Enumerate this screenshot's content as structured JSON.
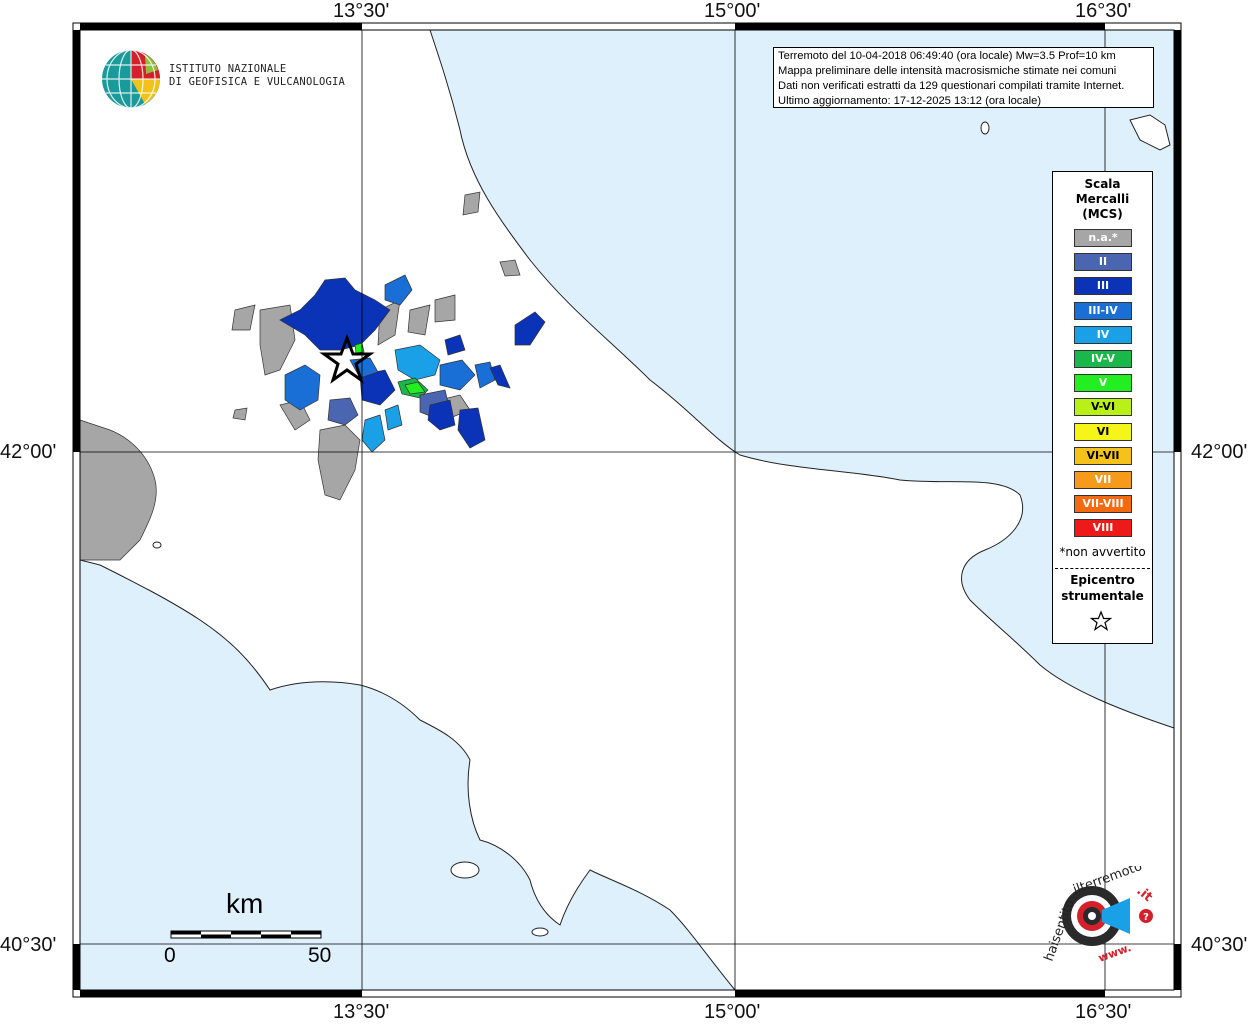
{
  "info": {
    "line1": "Terremoto del 10-04-2018 06:49:40 (ora locale) Mw=3.5 Prof=10 km",
    "line2": "Mappa preliminare delle intensità macrosismiche stimate nei comuni",
    "line3": "Dati non verificati estratti da 129 questionari compilati tramite Internet.",
    "line4": "Ultimo aggiornamento: 17-12-2025 13:12 (ora locale)"
  },
  "ticks": {
    "lon_13_30": "13°30'",
    "lon_15_00": "15°00'",
    "lon_16_30": "16°30'",
    "lat_42_00": "42°00'",
    "lat_40_30": "40°30'"
  },
  "logo": {
    "line1": "ISTITUTO NAZIONALE",
    "line2": "DI GEOFISICA E VULCANOLOGIA"
  },
  "legend": {
    "title1": "Scala",
    "title2": "Mercalli",
    "title3": "(MCS)",
    "classes": [
      {
        "label": "n.a.*",
        "color": "#a6a6a6"
      },
      {
        "label": "II",
        "color": "#4a66b0"
      },
      {
        "label": "III",
        "color": "#0a33b8"
      },
      {
        "label": "III-IV",
        "color": "#1a6fd6"
      },
      {
        "label": "IV",
        "color": "#1aa0e6"
      },
      {
        "label": "IV-V",
        "color": "#1ab84a"
      },
      {
        "label": "V",
        "color": "#22ee22"
      },
      {
        "label": "V-VI",
        "color": "#b8f018"
      },
      {
        "label": "VI",
        "color": "#f5f51a"
      },
      {
        "label": "VI-VII",
        "color": "#f5c21a"
      },
      {
        "label": "VII",
        "color": "#f59a1a"
      },
      {
        "label": "VII-VIII",
        "color": "#f56a10"
      },
      {
        "label": "VIII",
        "color": "#ee1a1a"
      }
    ],
    "note": "*non avvertito",
    "epi1": "Epicentro",
    "epi2": "strumentale"
  },
  "scalebar": {
    "unit": "km",
    "min": "0",
    "max": "50"
  },
  "hsl_logo": {
    "text1": "haisentito",
    "text2": "ilterremoto",
    "text3": ".it",
    "text4": "www."
  },
  "colors": {
    "sea": "#dff0fd",
    "land": "#ffffff",
    "grid": "#000000"
  }
}
